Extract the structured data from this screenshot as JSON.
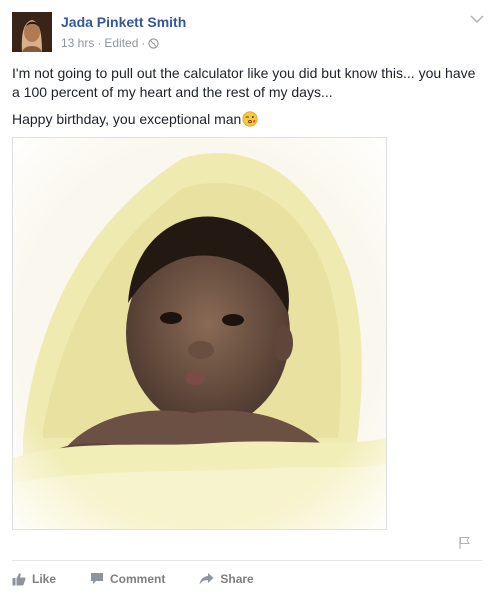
{
  "post": {
    "author": "Jada Pinkett Smith",
    "meta": {
      "time": "13 hrs",
      "separator": "·",
      "edited": "Edited",
      "separator2": "·",
      "privacy_icon": "globe-icon"
    },
    "paragraphs": [
      "I'm not going to pull out the calculator like you did but know this... you have a 100 percent of my heart and the rest of my days...",
      "Happy birthday, you exceptional man"
    ],
    "emoji": "kiss-emoji",
    "photo_alt": "baby-photo",
    "more_options_icon": "chevron-down-icon",
    "report_icon": "flag-icon"
  },
  "actions": [
    {
      "label": "Like",
      "icon": "thumbs-up-icon"
    },
    {
      "label": "Comment",
      "icon": "comment-icon"
    },
    {
      "label": "Share",
      "icon": "share-icon"
    }
  ],
  "colors": {
    "author_link": "#365899",
    "meta_text": "#90949c",
    "action_text": "#7f7f7f"
  }
}
